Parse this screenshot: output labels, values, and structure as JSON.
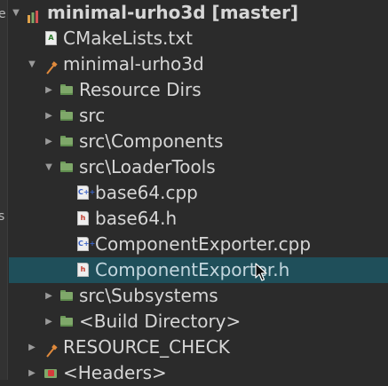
{
  "left_strip": {
    "fragments": [
      "e",
      "s"
    ]
  },
  "tree": {
    "root": {
      "label": "minimal-urho3d [master]"
    },
    "items": [
      {
        "label": "CMakeLists.txt",
        "icon": "cmake-file-icon"
      },
      {
        "label": "minimal-urho3d",
        "icon": "build-target-icon"
      },
      {
        "label": "Resource Dirs",
        "icon": "folder-icon"
      },
      {
        "label": "src",
        "icon": "folder-icon"
      },
      {
        "label": "src\\Components",
        "icon": "folder-icon"
      },
      {
        "label": "src\\LoaderTools",
        "icon": "folder-icon"
      },
      {
        "label": "base64.cpp",
        "icon": "cpp-file-icon",
        "glyph": "C++"
      },
      {
        "label": "base64.h",
        "icon": "header-file-icon",
        "glyph": "h"
      },
      {
        "label": "ComponentExporter.cpp",
        "icon": "cpp-file-icon",
        "glyph": "C++"
      },
      {
        "label": "ComponentExporter.h",
        "icon": "header-file-icon",
        "glyph": "h",
        "selected": true
      },
      {
        "label": "src\\Subsystems",
        "icon": "folder-icon"
      },
      {
        "label": "<Build Directory>",
        "icon": "folder-icon"
      },
      {
        "label": "RESOURCE_CHECK",
        "icon": "build-target-icon"
      },
      {
        "label": "<Headers>",
        "icon": "headers-folder-icon"
      }
    ],
    "arrows": {
      "expanded": "▼",
      "collapsed": "▶"
    },
    "cmake_glyph": "A"
  },
  "colors": {
    "background": "#2b2b2b",
    "selection": "#1f4f5a",
    "text": "#d6d6d6",
    "folder": "#7fa86a"
  }
}
